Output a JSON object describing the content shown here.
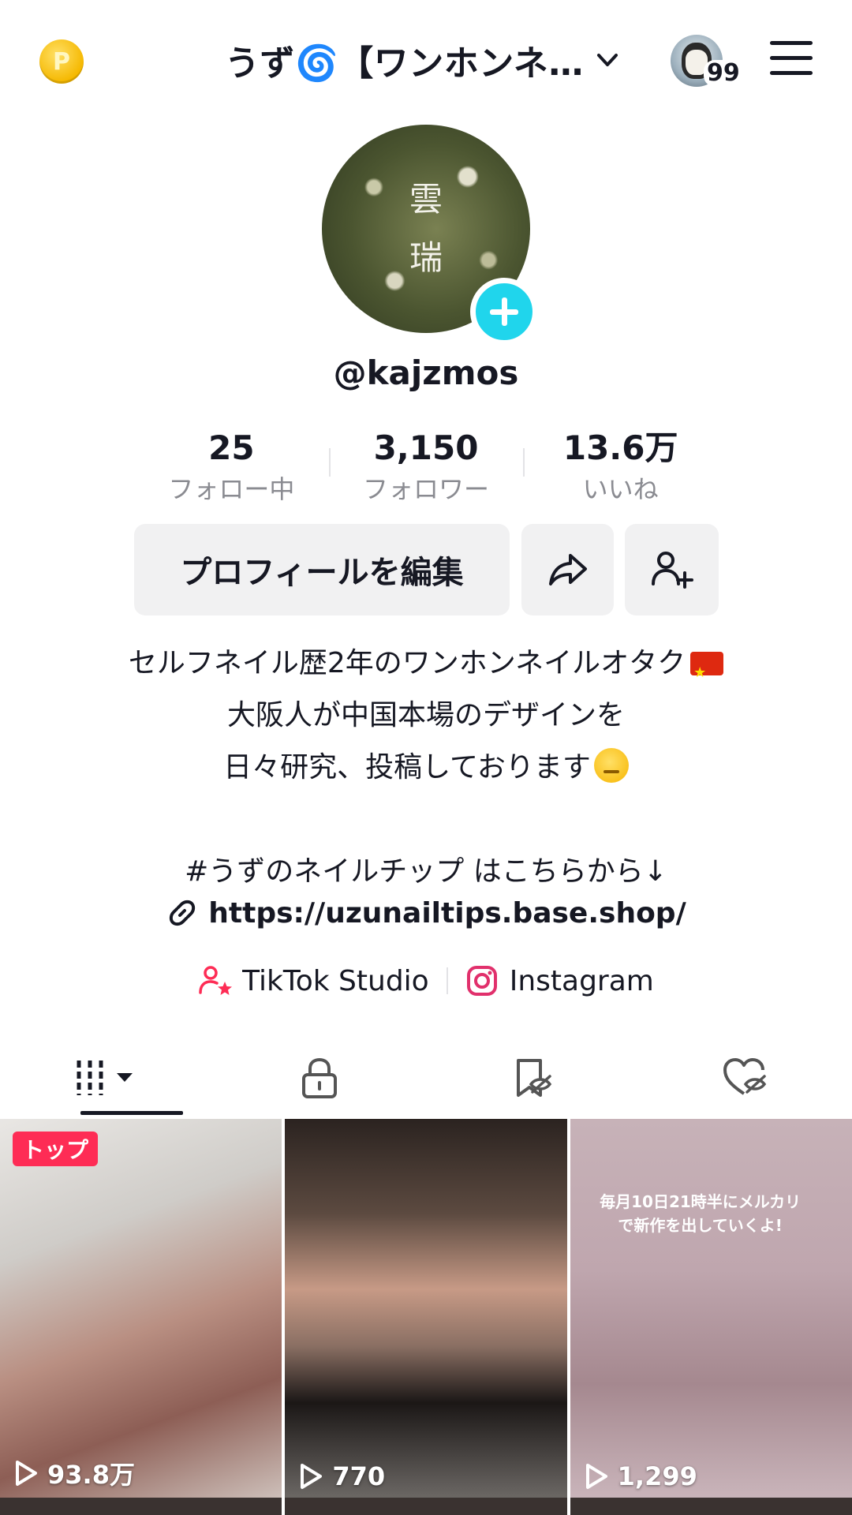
{
  "header": {
    "coin_label": "P",
    "account_name": "うず🌀【ワンホンネ…",
    "notification_count": "99"
  },
  "profile": {
    "avatar_text": [
      "雲",
      "瑞"
    ],
    "username": "@kajzmos"
  },
  "stats": [
    {
      "value": "25",
      "label": "フォロー中"
    },
    {
      "value": "3,150",
      "label": "フォロワー"
    },
    {
      "value": "13.6万",
      "label": "いいね"
    }
  ],
  "actions": {
    "edit_label": "プロフィールを編集"
  },
  "bio": {
    "line1": "セルフネイル歴2年のワンホンネイルオタク",
    "line2": "大阪人が中国本場のデザインを",
    "line3": "日々研究、投稿しております",
    "line4": "#うずのネイルチップ はこちらから↓"
  },
  "link": {
    "url": "https://uzunailtips.base.shop/"
  },
  "social": {
    "studio_label": "TikTok Studio",
    "instagram_label": "Instagram"
  },
  "tabs": [
    "videos",
    "private",
    "favorites",
    "liked"
  ],
  "videos": [
    {
      "views": "93.8万",
      "pinned": "トップ"
    },
    {
      "views": "770"
    },
    {
      "views": "1,299",
      "overlay": "毎月10日21時半にメルカリで新作を出していくよ!"
    }
  ],
  "colors": {
    "accent": "#fe2c55",
    "plus": "#20d5ec",
    "text": "#161823",
    "muted": "#8a8b91",
    "button_bg": "#f1f1f2"
  }
}
